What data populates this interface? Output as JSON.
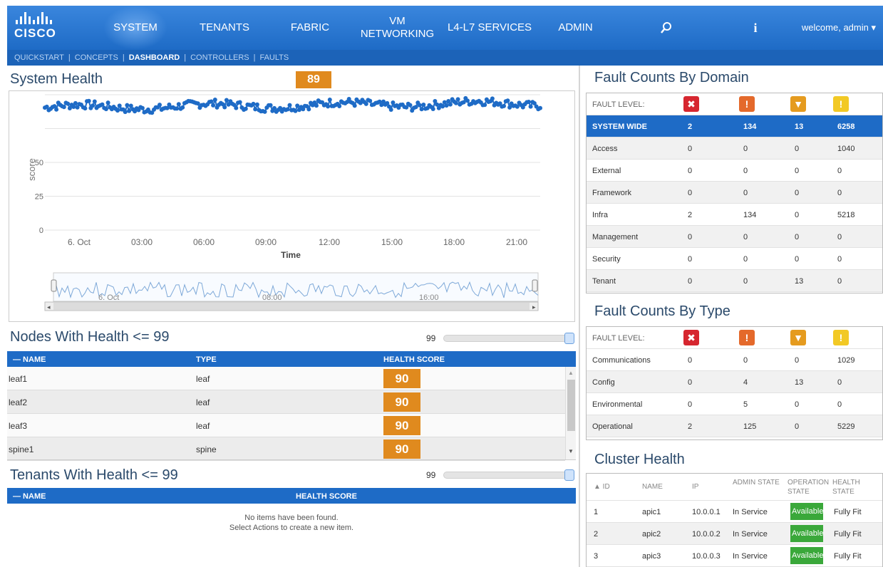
{
  "logo": "CISCO",
  "nav": [
    "SYSTEM",
    "TENANTS",
    "FABRIC",
    "VM\nNETWORKING",
    "L4-L7 SERVICES",
    "ADMIN"
  ],
  "nav_icons": {
    "search": "search-icon",
    "info": "info-icon"
  },
  "welcome": "welcome, admin ▾",
  "subnav": [
    "QUICKSTART",
    "CONCEPTS",
    "DASHBOARD",
    "CONTROLLERS",
    "FAULTS"
  ],
  "system_health": {
    "title": "System Health",
    "score": "89",
    "chart_data": {
      "type": "line",
      "ylabel": "score",
      "xlabel": "Time",
      "yticks": [
        "0",
        "25",
        "50"
      ],
      "xticks": [
        "6. Oct",
        "03:00",
        "06:00",
        "09:00",
        "12:00",
        "15:00",
        "18:00",
        "21:00"
      ],
      "navigator_labels": [
        "6. Oct",
        "08:00",
        "16:00"
      ],
      "series": [
        {
          "values_range": [
            86,
            99
          ]
        }
      ]
    }
  },
  "nodes": {
    "title": "Nodes With Health <= 99",
    "slider_value": "99",
    "headers": [
      "— NAME",
      "TYPE",
      "HEALTH SCORE"
    ],
    "rows": [
      {
        "name": "leaf1",
        "type": "leaf",
        "score": "90"
      },
      {
        "name": "leaf2",
        "type": "leaf",
        "score": "90"
      },
      {
        "name": "leaf3",
        "type": "leaf",
        "score": "90"
      },
      {
        "name": "spine1",
        "type": "spine",
        "score": "90"
      }
    ]
  },
  "tenants": {
    "title": "Tenants With Health <= 99",
    "slider_value": "99",
    "headers": [
      "— NAME",
      "HEALTH SCORE"
    ],
    "empty_line1": "No items have been found.",
    "empty_line2": "Select Actions to create a new item."
  },
  "fault_domain": {
    "title": "Fault Counts By Domain",
    "level_label": "FAULT LEVEL:",
    "rows": [
      {
        "name": "SYSTEM WIDE",
        "v": [
          "2",
          "134",
          "13",
          "6258"
        ]
      },
      {
        "name": "Access",
        "v": [
          "0",
          "0",
          "0",
          "1040"
        ]
      },
      {
        "name": "External",
        "v": [
          "0",
          "0",
          "0",
          "0"
        ]
      },
      {
        "name": "Framework",
        "v": [
          "0",
          "0",
          "0",
          "0"
        ]
      },
      {
        "name": "Infra",
        "v": [
          "2",
          "134",
          "0",
          "5218"
        ]
      },
      {
        "name": "Management",
        "v": [
          "0",
          "0",
          "0",
          "0"
        ]
      },
      {
        "name": "Security",
        "v": [
          "0",
          "0",
          "0",
          "0"
        ]
      },
      {
        "name": "Tenant",
        "v": [
          "0",
          "0",
          "13",
          "0"
        ]
      }
    ]
  },
  "fault_type": {
    "title": "Fault Counts By Type",
    "level_label": "FAULT LEVEL:",
    "rows": [
      {
        "name": "Communications",
        "v": [
          "0",
          "0",
          "0",
          "1029"
        ]
      },
      {
        "name": "Config",
        "v": [
          "0",
          "4",
          "13",
          "0"
        ]
      },
      {
        "name": "Environmental",
        "v": [
          "0",
          "5",
          "0",
          "0"
        ]
      },
      {
        "name": "Operational",
        "v": [
          "2",
          "125",
          "0",
          "5229"
        ]
      }
    ]
  },
  "severity_icons": [
    "critical-icon",
    "major-icon",
    "minor-icon",
    "warning-icon"
  ],
  "cluster": {
    "title": "Cluster Health",
    "headers": [
      "▲ ID",
      "NAME",
      "IP",
      "ADMIN STATE",
      "OPERATION STATE",
      "HEALTH STATE"
    ],
    "rows": [
      {
        "id": "1",
        "name": "apic1",
        "ip": "10.0.0.1",
        "admin": "In Service",
        "op": "Available",
        "health": "Fully Fit"
      },
      {
        "id": "2",
        "name": "apic2",
        "ip": "10.0.0.2",
        "admin": "In Service",
        "op": "Available",
        "health": "Fully Fit"
      },
      {
        "id": "3",
        "name": "apic3",
        "ip": "10.0.0.3",
        "admin": "In Service",
        "op": "Available",
        "health": "Fully Fit"
      }
    ]
  },
  "colors": {
    "nav_blue": "#1e6bc6",
    "score_orange": "#e08a1e",
    "available_green": "#3aa83a"
  }
}
